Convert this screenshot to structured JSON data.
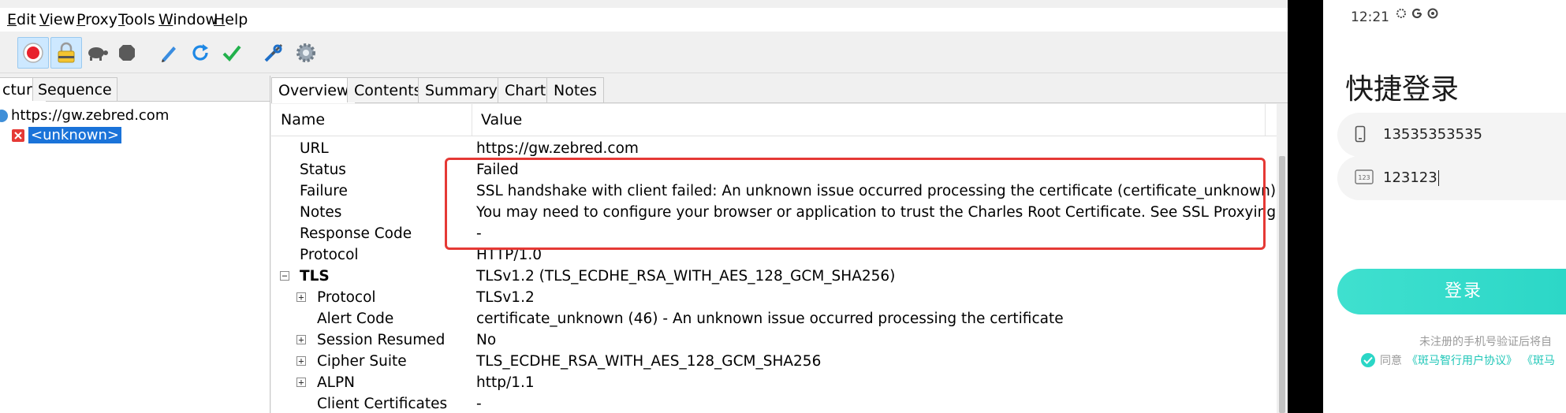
{
  "menu": [
    "Edit",
    "View",
    "Proxy",
    "Tools",
    "Window",
    "Help"
  ],
  "toolbar": {
    "icons": [
      "record-icon",
      "ssl-lock-icon",
      "turtle-icon",
      "stop-icon",
      "pen-icon",
      "refresh-icon",
      "check-icon",
      "tools-icon",
      "settings-gear-icon"
    ]
  },
  "left_panel": {
    "tabs": [
      "cture",
      "Sequence"
    ],
    "tree": {
      "host": "https://gw.zebred.com",
      "child": "<unknown>"
    }
  },
  "right_panel": {
    "tabs": [
      "Overview",
      "Contents",
      "Summary",
      "Chart",
      "Notes"
    ],
    "columns": {
      "name": "Name",
      "value": "Value"
    },
    "rows": [
      {
        "name": "URL",
        "value": "https://gw.zebred.com"
      },
      {
        "name": "Status",
        "value": "Failed"
      },
      {
        "name": "Failure",
        "value": "SSL handshake with client failed: An unknown issue occurred processing the certificate (certificate_unknown)"
      },
      {
        "name": "Notes",
        "value": "You may need to configure your browser or application to trust the Charles Root Certificate. See SSL Proxying in the."
      },
      {
        "name": "Response Code",
        "value": "-"
      },
      {
        "name": "Protocol",
        "value": "HTTP/1.0"
      },
      {
        "name": "TLS",
        "value": "TLSv1.2 (TLS_ECDHE_RSA_WITH_AES_128_GCM_SHA256)"
      },
      {
        "name": "Protocol",
        "value": "TLSv1.2"
      },
      {
        "name": "Alert Code",
        "value": "certificate_unknown (46) - An unknown issue occurred processing the certificate"
      },
      {
        "name": "Session Resumed",
        "value": "No"
      },
      {
        "name": "Cipher Suite",
        "value": "TLS_ECDHE_RSA_WITH_AES_128_GCM_SHA256"
      },
      {
        "name": "ALPN",
        "value": "http/1.1"
      },
      {
        "name": "Client Certificates",
        "value": "-"
      }
    ]
  },
  "phone": {
    "time": "12:21",
    "title": "快捷登录",
    "phone_number": "13535353535",
    "code": "123123",
    "login_label": "登录",
    "hint": "未注册的手机号验证后将自",
    "agree_prefix": "同意",
    "agree_link1": "《斑马智行用户协议》",
    "agree_link2": "《斑马",
    "accent_color": "#2ad6c6"
  }
}
